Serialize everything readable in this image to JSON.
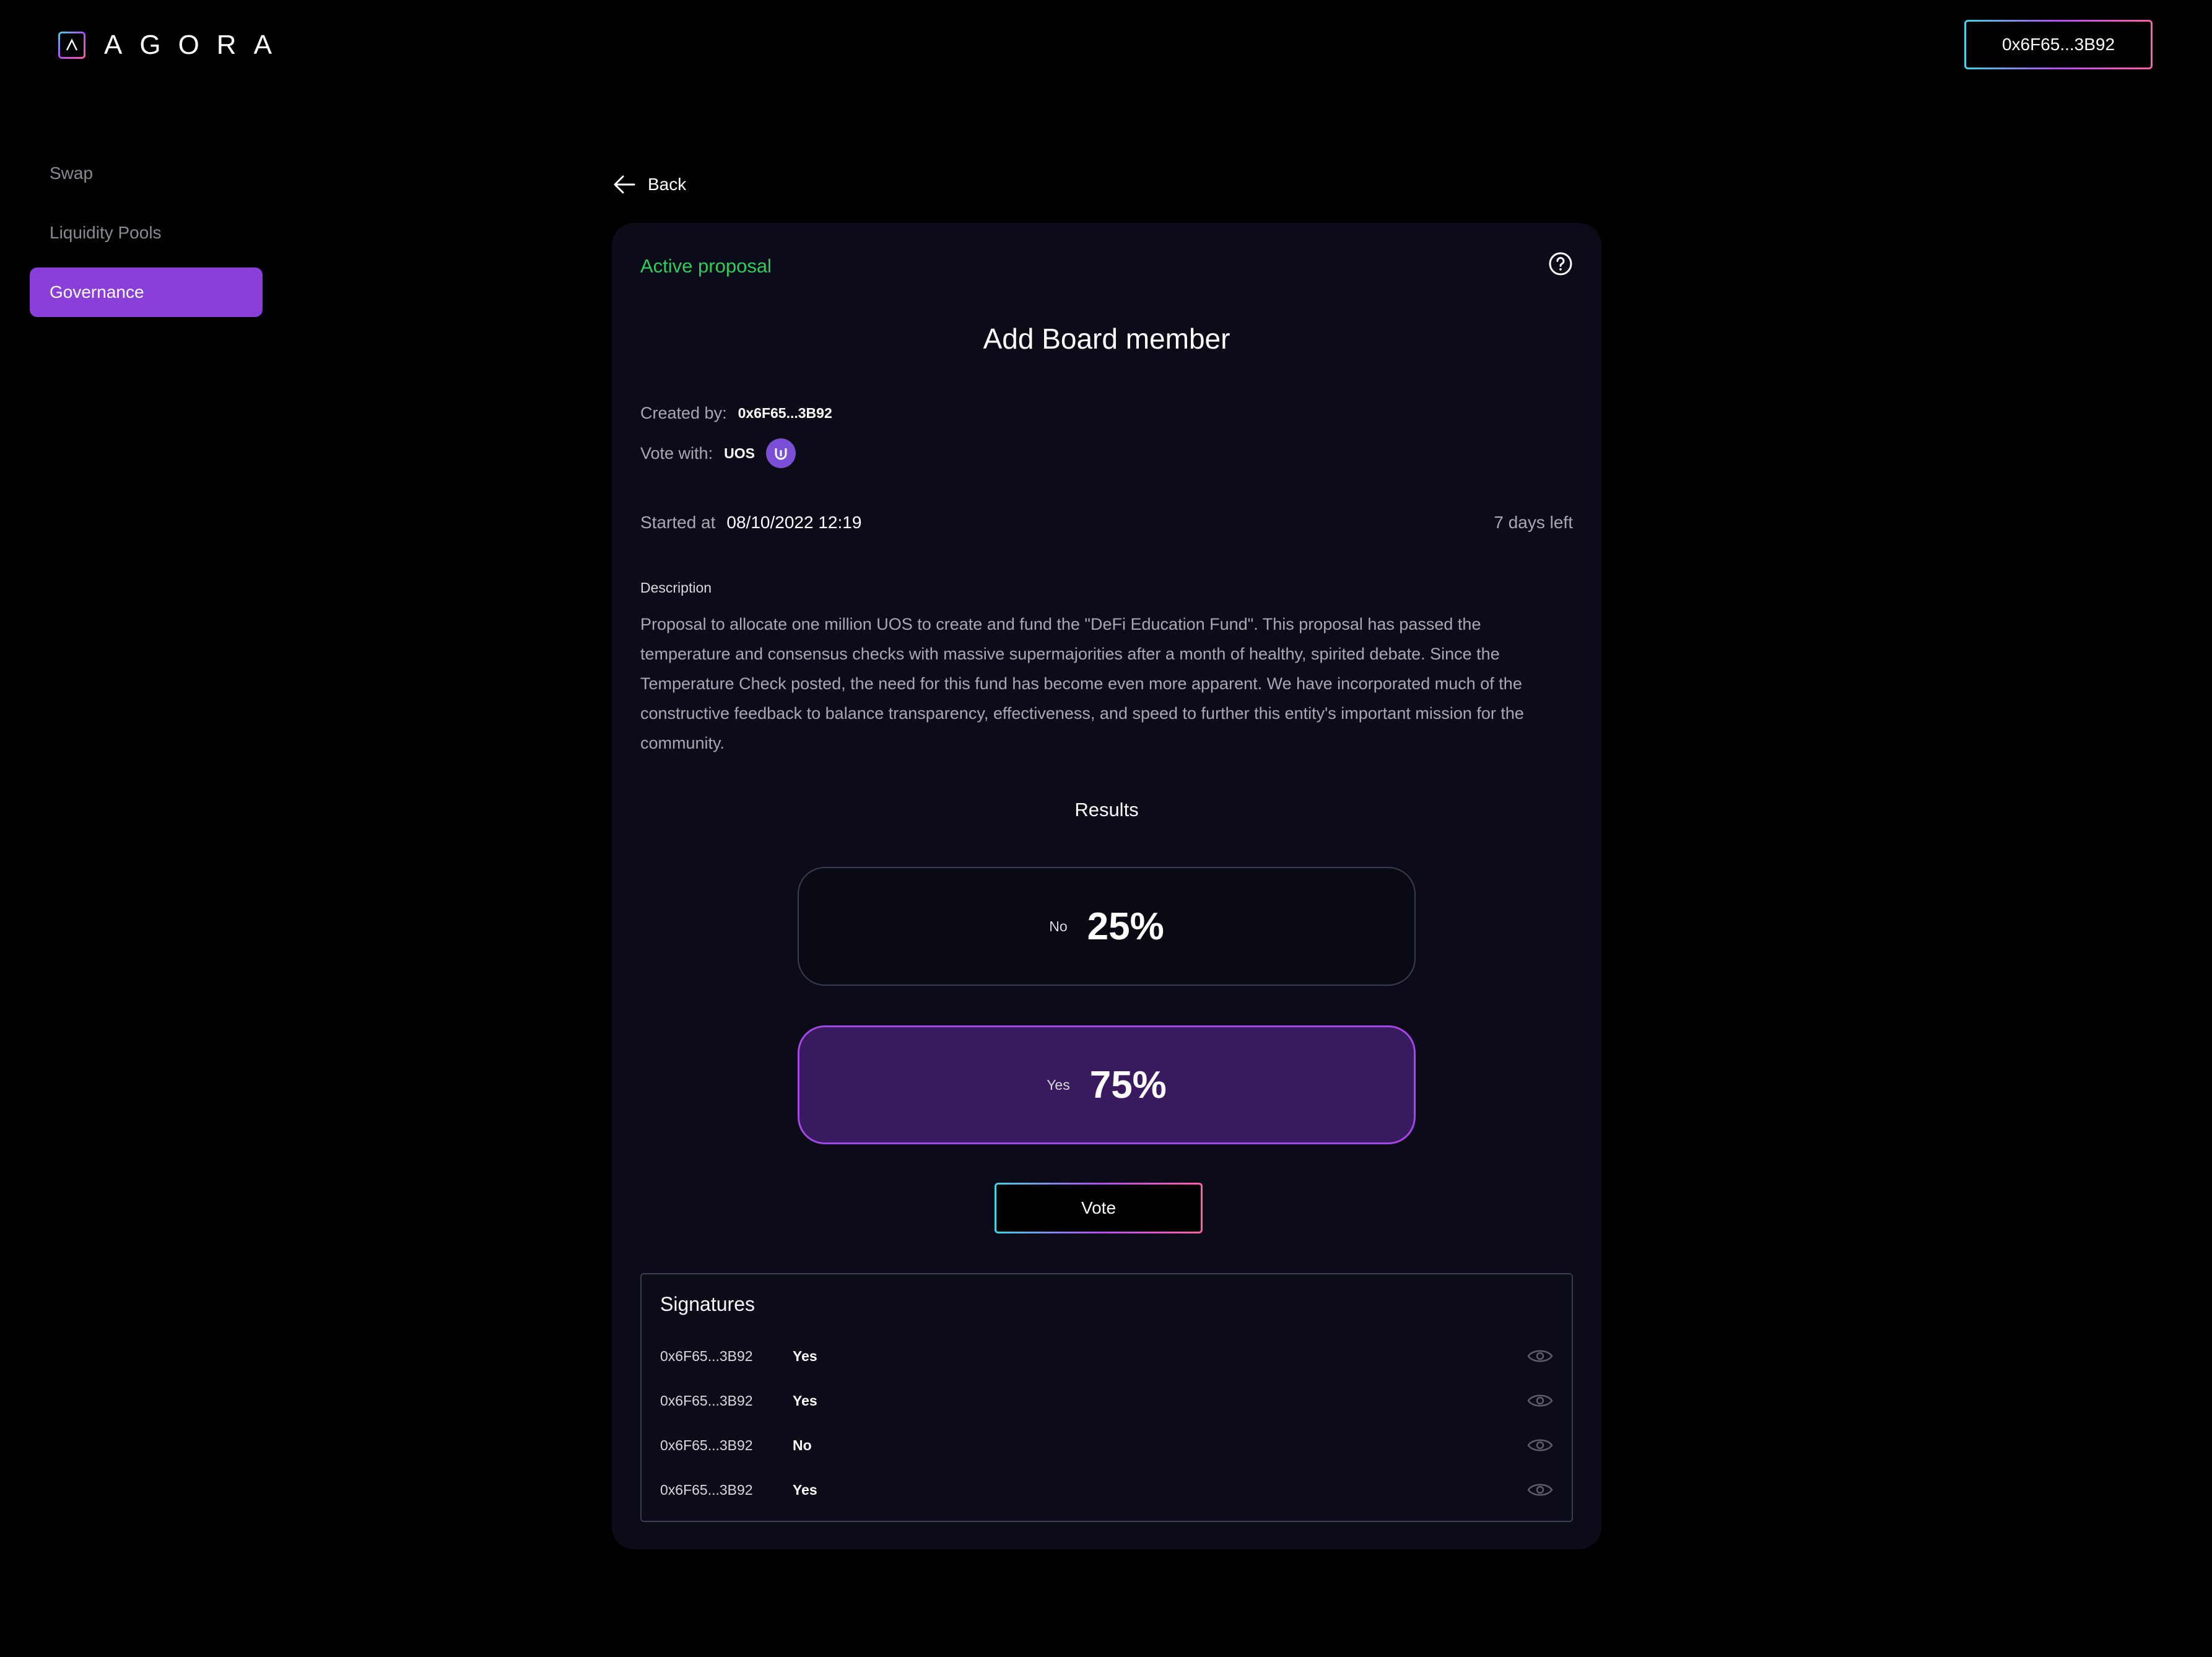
{
  "header": {
    "logo_text": "AGORA",
    "logo_icon": "agora-logo-icon",
    "wallet_address": "0x6F65...3B92"
  },
  "sidebar": {
    "items": [
      {
        "label": "Swap",
        "active": false
      },
      {
        "label": "Liquidity Pools",
        "active": false
      },
      {
        "label": "Governance",
        "active": true
      }
    ]
  },
  "back": {
    "label": "Back",
    "icon": "arrow-left-icon"
  },
  "proposal": {
    "status": "Active proposal",
    "title": "Add Board member",
    "created_by_label": "Created by:",
    "created_by": "0x6F65...3B92",
    "vote_with_label": "Vote with:",
    "vote_with": "UOS",
    "started_label": "Started at",
    "started_at": "08/10/2022 12:19",
    "time_left": "7 days left",
    "description_label": "Description",
    "description": "Proposal to allocate one million UOS to create and fund the \"DeFi Education Fund\". This proposal has passed the temperature and consensus checks with massive supermajorities after a month of healthy, spirited debate. Since the Temperature Check posted, the need for this fund has become even more apparent. We have incorporated much of the constructive feedback to balance transparency, effectiveness, and speed to further this entity's important mission for the community."
  },
  "results": {
    "label": "Results",
    "options": [
      {
        "label": "No",
        "percent": "25%"
      },
      {
        "label": "Yes",
        "percent": "75%"
      }
    ]
  },
  "vote_button": "Vote",
  "signatures": {
    "title": "Signatures",
    "rows": [
      {
        "address": "0x6F65...3B92",
        "vote": "Yes"
      },
      {
        "address": "0x6F65...3B92",
        "vote": "Yes"
      },
      {
        "address": "0x6F65...3B92",
        "vote": "No"
      },
      {
        "address": "0x6F65...3B92",
        "vote": "Yes"
      }
    ]
  },
  "colors": {
    "accent": "#8b3fd9",
    "status_active": "#2ecc5e",
    "card_bg": "#0c0c18"
  }
}
